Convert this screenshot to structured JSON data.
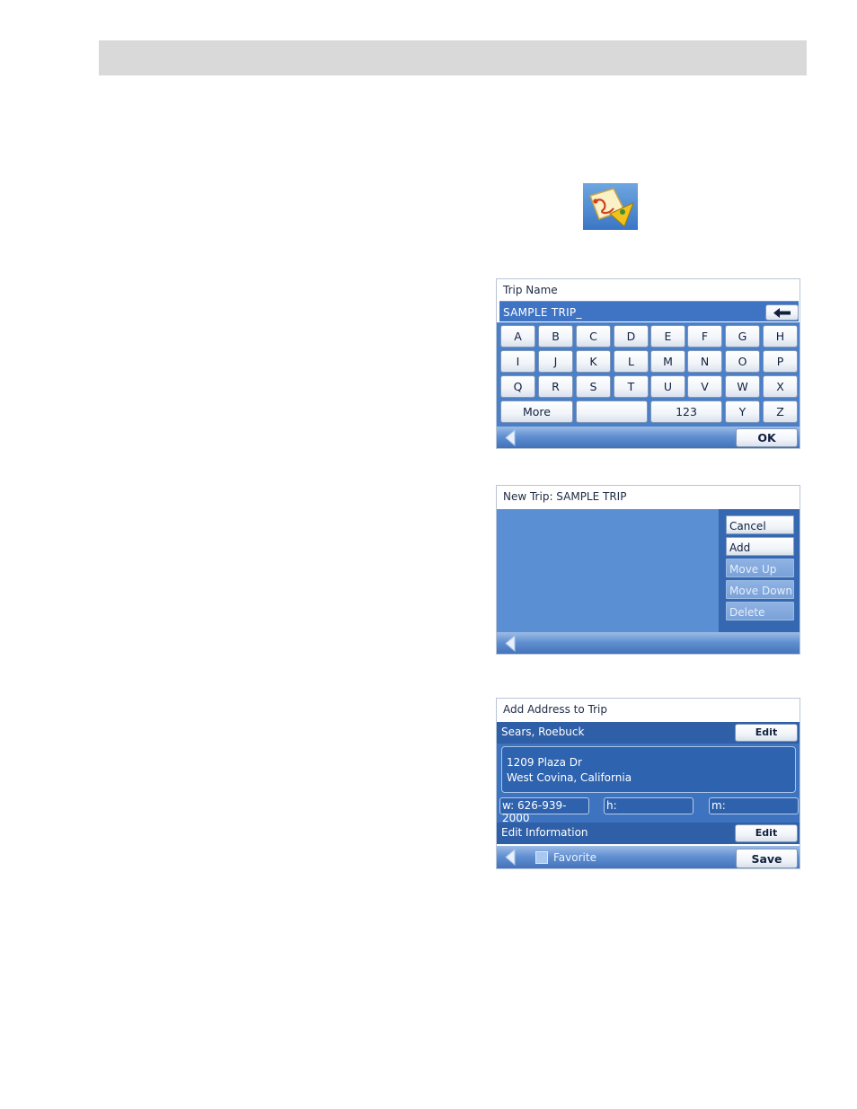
{
  "icons": {
    "app_icon": "trip-planner-icon",
    "back": "back-arrow-icon",
    "backspace": "backspace-arrow-icon"
  },
  "colors": {
    "header_bar": "#d9d9d9",
    "screen_blue": "#4b80c8",
    "dark_blue": "#2f5fa6"
  },
  "trip_name_screen": {
    "title": "Trip Name",
    "input_value": "SAMPLE TRIP_",
    "keys_row1": [
      "A",
      "B",
      "C",
      "D",
      "E",
      "F",
      "G",
      "H"
    ],
    "keys_row2": [
      "I",
      "J",
      "K",
      "L",
      "M",
      "N",
      "O",
      "P"
    ],
    "keys_row3": [
      "Q",
      "R",
      "S",
      "T",
      "U",
      "V",
      "W",
      "X"
    ],
    "more_label": "More",
    "space_label": "",
    "numbers_label": "123",
    "key_y": "Y",
    "key_z": "Z",
    "ok_label": "OK"
  },
  "new_trip_screen": {
    "title": "New Trip: SAMPLE TRIP",
    "buttons": [
      {
        "label": "Cancel",
        "enabled": true
      },
      {
        "label": "Add",
        "enabled": true
      },
      {
        "label": "Move Up",
        "enabled": false
      },
      {
        "label": "Move Down",
        "enabled": false
      },
      {
        "label": "Delete",
        "enabled": false
      }
    ]
  },
  "add_address_screen": {
    "title": "Add Address to Trip",
    "place_name": "Sears, Roebuck",
    "edit_label": "Edit",
    "address_line1": "1209 Plaza Dr",
    "address_line2": "West Covina, California",
    "phone_work": "w: 626-939-2000",
    "phone_home": "h:",
    "phone_mobile": "m:",
    "edit_info_label": "Edit Information",
    "edit_label_2": "Edit",
    "favorite_label": "Favorite",
    "save_label": "Save"
  }
}
